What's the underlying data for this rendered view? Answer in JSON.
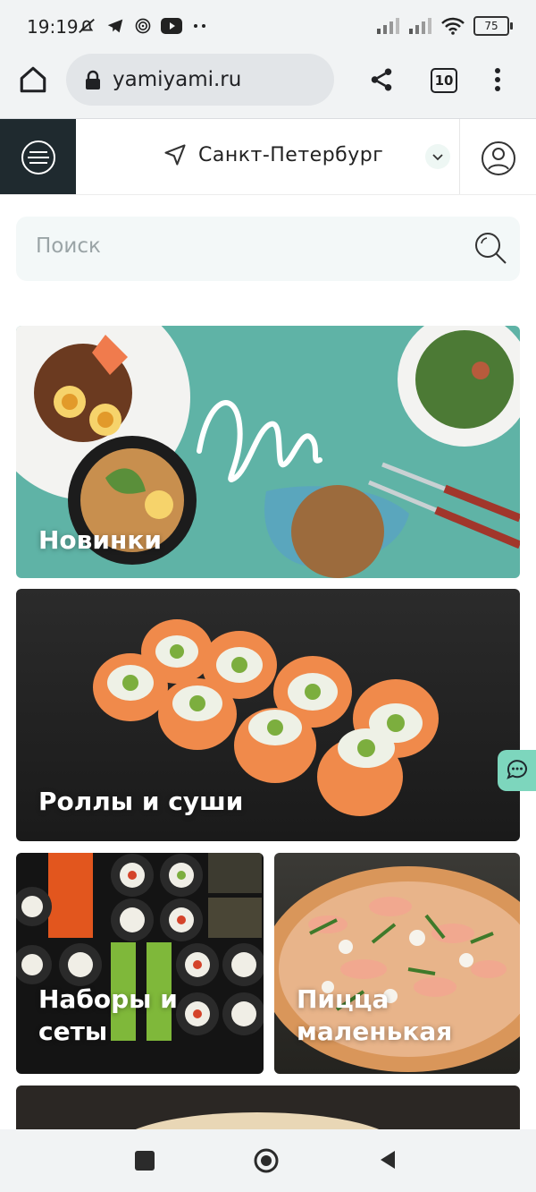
{
  "status_bar": {
    "time": "19:19",
    "battery": "75"
  },
  "browser": {
    "url": "yamiyami.ru",
    "tab_count": "10"
  },
  "site_header": {
    "city": "Санкт-Петербург"
  },
  "search": {
    "placeholder": "Поиск"
  },
  "categories": [
    {
      "label": "Новинки"
    },
    {
      "label": "Роллы и суши"
    },
    {
      "label": "Наборы и сеты"
    },
    {
      "label": "Пицца маленькая"
    }
  ],
  "colors": {
    "accent": "#7dd6bd",
    "header_dark": "#1f2a2f",
    "new_banner": "#5fb3a6"
  }
}
